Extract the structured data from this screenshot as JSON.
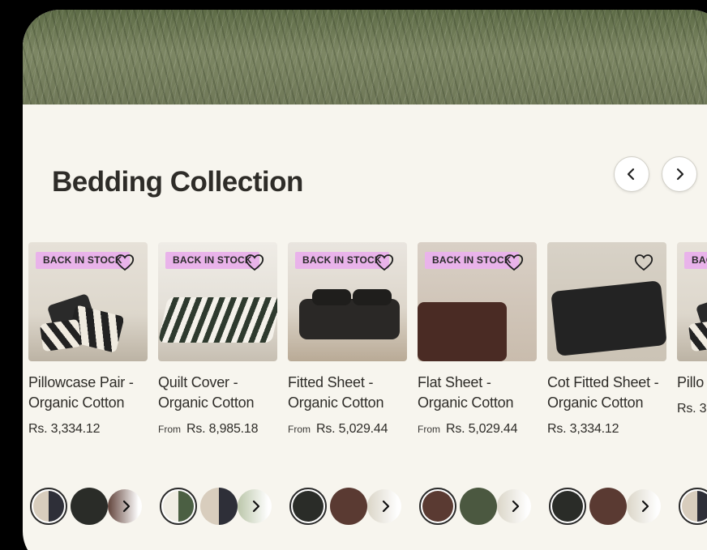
{
  "section": {
    "title": "Bedding Collection",
    "nav": {
      "prev_icon": "chevron-left-icon",
      "next_icon": "chevron-right-icon"
    }
  },
  "products": [
    {
      "badge": "BACK IN STOCK",
      "name": "Pillowcase Pair - Organic Cotton",
      "from": "",
      "price": "Rs. 3,334.12",
      "swatches": [
        "#d8cdbd/#2e2f38",
        "#2a2c28",
        "#5a3a32"
      ]
    },
    {
      "badge": "BACK IN STOCK",
      "name": "Quilt Cover - Organic Cotton",
      "from": "From",
      "price": "Rs. 8,985.18",
      "swatches": [
        "#f0ede4/#4b5f43",
        "#d8cdbd/#2e2f38",
        "#b8c4a6"
      ]
    },
    {
      "badge": "BACK IN STOCK",
      "name": "Fitted Sheet - Organic Cotton",
      "from": "From",
      "price": "Rs. 5,029.44",
      "swatches": [
        "#2a2c28",
        "#5a3a32",
        "#d9d4c6"
      ]
    },
    {
      "badge": "BACK IN STOCK",
      "name": "Flat Sheet - Organic Cotton",
      "from": "From",
      "price": "Rs. 5,029.44",
      "swatches": [
        "#5a3a32",
        "#4b5840",
        "#d9d4c6"
      ]
    },
    {
      "badge": "",
      "name": "Cot Fitted Sheet - Organic Cotton",
      "from": "",
      "price": "Rs. 3,334.12",
      "swatches": [
        "#2a2c28",
        "#5a3a32",
        "#d9d4c6"
      ]
    },
    {
      "badge": "BAC",
      "name": "Pillo Orga",
      "from": "",
      "price": "Rs. 3",
      "swatches": [
        "#d8cdbd/#2e2f38"
      ]
    }
  ],
  "icons": {
    "wishlist": "heart-icon",
    "more_colors": "chevron-right-icon"
  }
}
